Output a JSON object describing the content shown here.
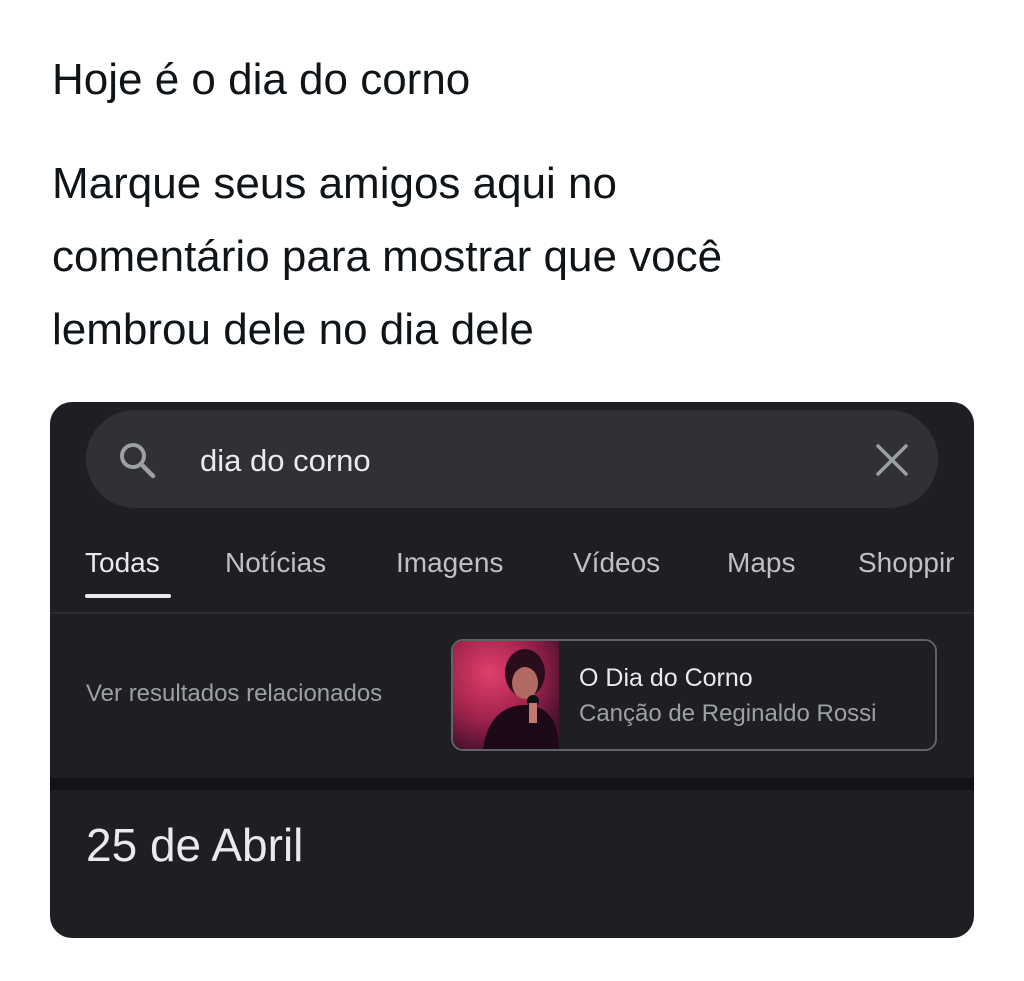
{
  "tweet": {
    "line1": "Hoje é o dia do corno",
    "body_lines": [
      "Marque seus amigos aqui no",
      "comentário para mostrar que você",
      "lembrou dele no dia dele"
    ]
  },
  "search": {
    "query": "dia do corno",
    "icon": "search-icon",
    "clear_icon": "close-icon"
  },
  "tabs": [
    {
      "label": "Todas",
      "active": true
    },
    {
      "label": "Notícias",
      "active": false
    },
    {
      "label": "Imagens",
      "active": false
    },
    {
      "label": "Vídeos",
      "active": false
    },
    {
      "label": "Maps",
      "active": false
    },
    {
      "label": "Shoppir",
      "active": false
    }
  ],
  "related": {
    "label": "Ver resultados relacionados",
    "card": {
      "title": "O Dia do Corno",
      "subtitle": "Canção de Reginaldo Rossi"
    }
  },
  "answer": "25 de Abril",
  "colors": {
    "card_bg": "#1f1e23",
    "search_bg": "#303035",
    "text_primary": "#e8eaed",
    "text_secondary": "#9aa0a6"
  }
}
